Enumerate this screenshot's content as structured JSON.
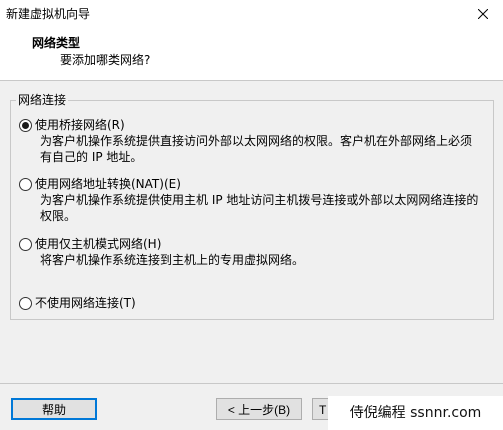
{
  "window": {
    "title": "新建虚拟机向导"
  },
  "header": {
    "title": "网络类型",
    "subtitle": "要添加哪类网络?"
  },
  "network_group": {
    "label": "网络连接",
    "options": [
      {
        "label": "使用桥接网络(R)",
        "selected": true,
        "description_lines": [
          "为客户机操作系统提供直接访问外部以太网网络的权限。客户机在外部网络上必须",
          "有自己的 IP 地址。"
        ]
      },
      {
        "label": "使用网络地址转换(NAT)(E)",
        "selected": false,
        "description_lines": [
          "为客户机操作系统提供使用主机 IP 地址访问主机拨号连接或外部以太网网络连接的",
          "权限。"
        ]
      },
      {
        "label": "使用仅主机模式网络(H)",
        "selected": false,
        "description_lines": [
          "将客户机操作系统连接到主机上的专用虚拟网络。"
        ]
      },
      {
        "label": "不使用网络连接(T)",
        "selected": false,
        "description_lines": []
      }
    ]
  },
  "footer": {
    "help_label": "帮助",
    "back_label": "< 上一步(B)",
    "next_label": "下一步(N) >",
    "next_visible_label": "T"
  },
  "watermark": {
    "text": "侍倪编程 ssnnr.com"
  },
  "colors": {
    "focus_border": "#0078d7",
    "button_face": "#e1e1e1",
    "dialog_bg": "#f0f0f0",
    "header_bg": "#ffffff"
  }
}
